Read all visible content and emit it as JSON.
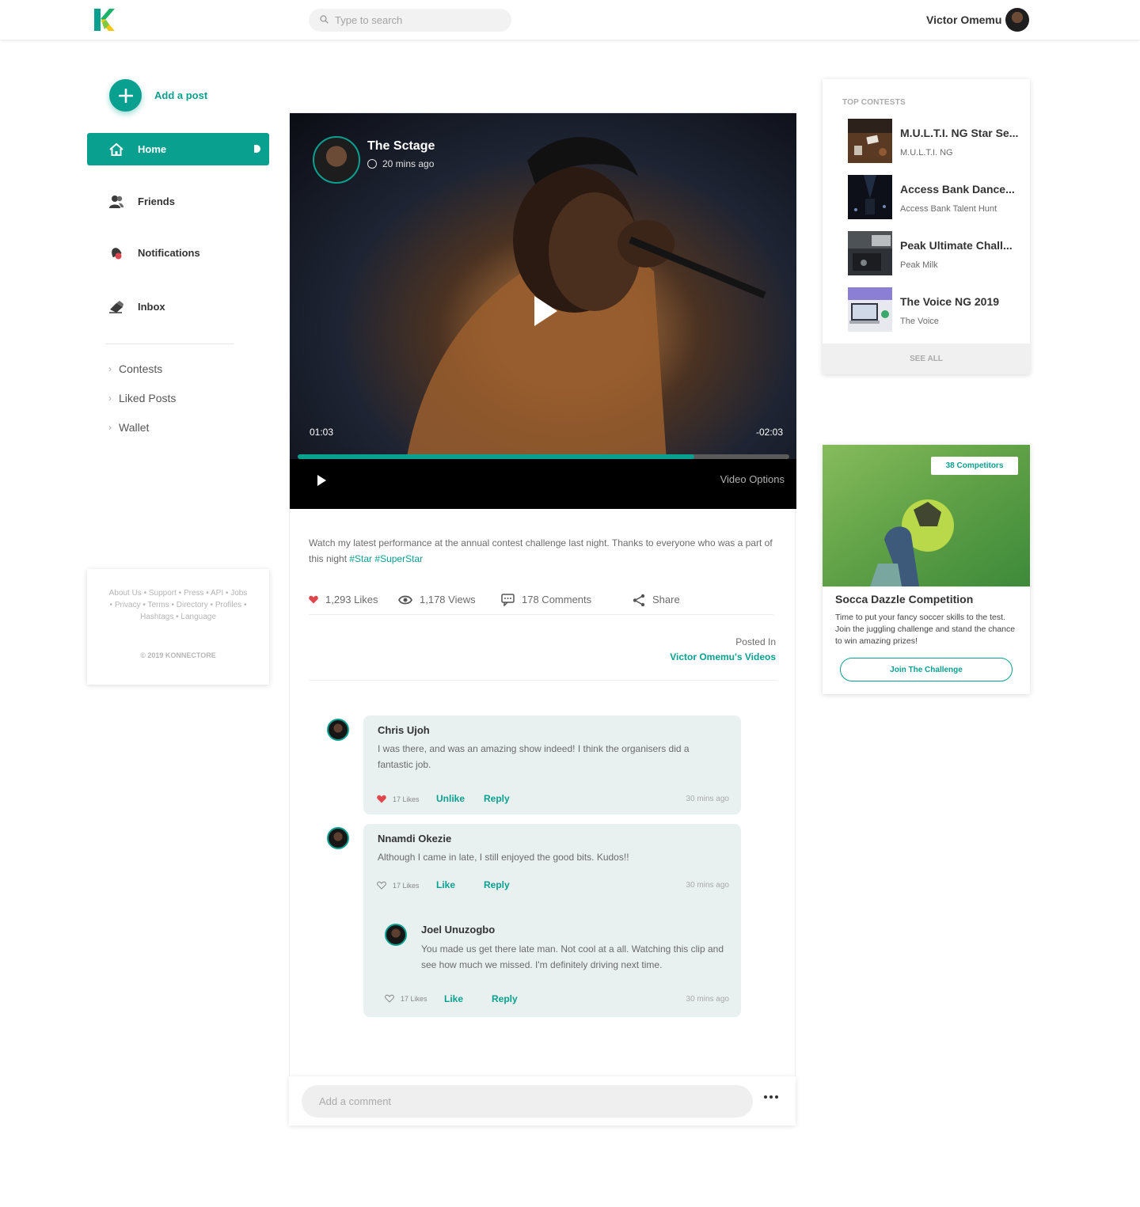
{
  "header": {
    "search_placeholder": "Type to search",
    "user_name": "Victor Omemu"
  },
  "sidebar": {
    "add_post_label": "Add a post",
    "nav": [
      {
        "label": "Home",
        "icon": "home-icon",
        "active": true
      },
      {
        "label": "Friends",
        "icon": "friends-icon"
      },
      {
        "label": "Notifications",
        "icon": "notifications-icon"
      },
      {
        "label": "Inbox",
        "icon": "inbox-icon"
      }
    ],
    "sub_links": [
      "Contests",
      "Liked Posts",
      "Wallet"
    ],
    "footer_links_line1": "About Us • Support • Press • API • Jobs",
    "footer_links_line2": "• Privacy • Terms • Directory • Profiles •",
    "footer_links_line3": "Hashtags • Language",
    "copyright": "© 2019 KONNECTORE"
  },
  "post": {
    "channel_name": "The Sctage",
    "time_ago": "20 mins ago",
    "elapsed": "01:03",
    "remaining": "-02:03",
    "progress": 0.806,
    "video_options": "Video Options",
    "caption": "Watch my latest performance at the annual contest challenge last night. Thanks to everyone who was a part of this night",
    "hashtags": "#Star #SuperStar",
    "likes": "1,293 Likes",
    "views": "1,178 Views",
    "comments": "178 Comments",
    "share": "Share",
    "posted_in_label": "Posted In",
    "posted_in_link": "Victor Omemu's Videos"
  },
  "comments": [
    {
      "name": "Chris Ujoh",
      "text": "I was there, and was an amazing show indeed! I think the organisers did a fantastic job.",
      "likes": "17 Likes",
      "like_action": "Unlike",
      "reply": "Reply",
      "time": "30 mins ago",
      "liked": true
    },
    {
      "name": "Nnamdi Okezie",
      "text": "Although I came in late, I still enjoyed the good bits. Kudos!!",
      "likes": "17 Likes",
      "like_action": "Like",
      "reply": "Reply",
      "time": "30 mins ago",
      "liked": false,
      "replies": [
        {
          "name": "Joel Unuzogbo",
          "text": "You made us get there late man. Not cool at a all. Watching this clip and see how much we missed. I'm definitely driving next time.",
          "likes": "17 Likes",
          "like_action": "Like",
          "reply": "Reply",
          "time": "30 mins ago",
          "liked": false
        }
      ]
    }
  ],
  "comment_box": {
    "placeholder": "Add a comment"
  },
  "top_contests": {
    "title": "TOP CONTESTS",
    "items": [
      {
        "title": "M.U.L.T.I. NG Star Se...",
        "sponsor": "M.U.L.T.I. NG"
      },
      {
        "title": "Access Bank Dance...",
        "sponsor": "Access Bank Talent Hunt"
      },
      {
        "title": "Peak Ultimate Chall...",
        "sponsor": "Peak Milk"
      },
      {
        "title": "The Voice NG 2019",
        "sponsor": "The Voice"
      }
    ],
    "see_all": "SEE ALL"
  },
  "promo": {
    "badge": "38 Competitors",
    "title": "Socca Dazzle Competition",
    "text": "Time to put your fancy soccer skills to the test. Join the juggling challenge and stand the chance to win amazing prizes!",
    "button": "Join The Challenge"
  },
  "colors": {
    "accent": "#0aa090",
    "heart": "#e0464e",
    "bubble": "#e8f1f0"
  }
}
